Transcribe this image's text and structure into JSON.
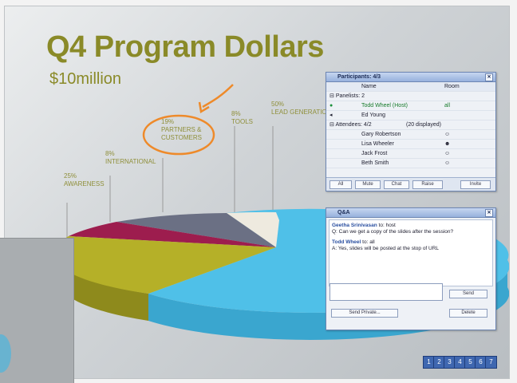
{
  "slide": {
    "title": "Q4 Program Dollars",
    "subtitle": "$10million"
  },
  "chart_data": {
    "type": "pie",
    "title": "",
    "slices": [
      {
        "pct": "25%",
        "label": "AWARENESS",
        "color": "#b5b028"
      },
      {
        "pct": "8%",
        "label": "INTERNATIONAL",
        "color": "#9d1d4e"
      },
      {
        "pct": "19%",
        "label": "PARTNERS & CUSTOMERS",
        "color": "#6b7084"
      },
      {
        "pct": "8%",
        "label": "TOOLS",
        "color": "#eeeadf"
      },
      {
        "pct": "50%",
        "label": "LEAD GENERATION",
        "color": "#4fc0e8"
      }
    ],
    "annotation": "orange circle and arrow highlighting 19% PARTNERS & CUSTOMERS"
  },
  "participants": {
    "title": "Participants: 4/3",
    "col_name": "Name",
    "col_role": "Room",
    "presenters_label": "Panelists: 2",
    "rows": [
      {
        "name": "Todd Wheel (Host)",
        "role": "all"
      },
      {
        "name": "Ed Young",
        "role": ""
      }
    ],
    "attendees_label": "Attendees: 4/2",
    "attendees_right": "(20 displayed)",
    "attendees": [
      {
        "name": "Gary Robertson"
      },
      {
        "name": "Lisa Wheeler"
      },
      {
        "name": "Jack Frost"
      },
      {
        "name": "Beth Smith"
      }
    ],
    "buttons": [
      "All",
      "Mute",
      "Chat",
      "Raise",
      "Invite"
    ]
  },
  "qa": {
    "title": "Q&A",
    "entries": [
      {
        "name": "Geetha Srinivasan",
        "suffix": "to: host",
        "q": "Q: Can we get a copy of the slides after the session?"
      },
      {
        "name": "Todd Wheel",
        "suffix": "to: all",
        "q": "A: Yes, slides will be posted at the stop of URL"
      }
    ],
    "send_label": "Send",
    "private_label": "Send Private...",
    "delete_label": "Delete"
  },
  "nav": [
    "1",
    "2",
    "3",
    "4",
    "5",
    "6",
    "7"
  ]
}
